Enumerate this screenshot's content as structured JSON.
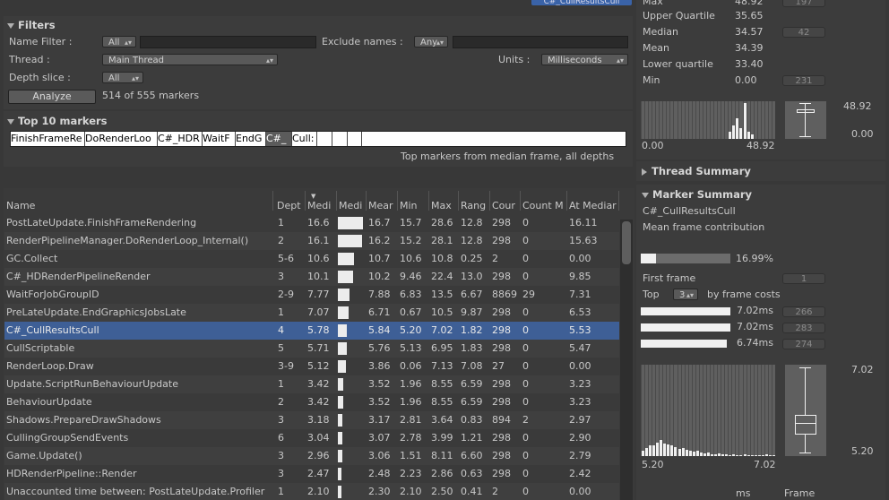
{
  "filters": {
    "title": "Filters",
    "name_filter_label": "Name Filter :",
    "name_filter_dropdown": "All",
    "exclude_names_label": "Exclude names :",
    "exclude_dropdown": "Any",
    "thread_label": "Thread :",
    "thread_value": "Main Thread",
    "units_label": "Units :",
    "units_value": "Milliseconds",
    "depth_label": "Depth slice :",
    "depth_value": "All",
    "analyze_button": "Analyze",
    "marker_count": "514 of 555 markers"
  },
  "top_markers": {
    "title": "Top 10 markers",
    "segments": [
      "FinishFrameRe",
      "DoRenderLoo",
      "C#_HDR",
      "WaitF",
      "EndG",
      "C#_",
      "Cull:",
      "",
      "",
      ""
    ],
    "caption": "Top markers from median frame, all depths"
  },
  "table": {
    "columns": [
      "Name",
      "Dept",
      "Medi",
      "Medi",
      "Mear",
      "Min",
      "Max",
      "Rang",
      "Cour",
      "Count M",
      "At Mediar"
    ],
    "rows": [
      {
        "name": "PostLateUpdate.FinishFrameRendering",
        "depth": "1",
        "median": "16.6",
        "bar": 1.0,
        "mean": "16.7",
        "min": "15.7",
        "max": "28.6",
        "range": "12.8",
        "count": "298",
        "count_m": "0",
        "at_median": "16.11"
      },
      {
        "name": "RenderPipelineManager.DoRenderLoop_Internal()",
        "depth": "2",
        "median": "16.1",
        "bar": 0.97,
        "mean": "16.2",
        "min": "15.2",
        "max": "28.1",
        "range": "12.8",
        "count": "298",
        "count_m": "0",
        "at_median": "15.63"
      },
      {
        "name": "GC.Collect",
        "depth": "5-6",
        "median": "10.6",
        "bar": 0.64,
        "mean": "10.7",
        "min": "10.6",
        "max": "10.8",
        "range": "0.25",
        "count": "2",
        "count_m": "0",
        "at_median": "0.00"
      },
      {
        "name": "C#_HDRenderPipelineRender",
        "depth": "3",
        "median": "10.1",
        "bar": 0.61,
        "mean": "10.2",
        "min": "9.46",
        "max": "22.4",
        "range": "13.0",
        "count": "298",
        "count_m": "0",
        "at_median": "9.85"
      },
      {
        "name": "WaitForJobGroupID",
        "depth": "2-9",
        "median": "7.77",
        "bar": 0.47,
        "mean": "7.88",
        "min": "6.83",
        "max": "13.5",
        "range": "6.67",
        "count": "8869",
        "count_m": "29",
        "at_median": "7.31"
      },
      {
        "name": "PreLateUpdate.EndGraphicsJobsLate",
        "depth": "1",
        "median": "7.07",
        "bar": 0.43,
        "mean": "6.71",
        "min": "0.67",
        "max": "10.5",
        "range": "9.87",
        "count": "298",
        "count_m": "0",
        "at_median": "6.53"
      },
      {
        "name": "C#_CullResultsCull",
        "depth": "4",
        "median": "5.78",
        "bar": 0.35,
        "mean": "5.84",
        "min": "5.20",
        "max": "7.02",
        "range": "1.82",
        "count": "298",
        "count_m": "0",
        "at_median": "5.53",
        "selected": true
      },
      {
        "name": "CullScriptable",
        "depth": "5",
        "median": "5.71",
        "bar": 0.34,
        "mean": "5.76",
        "min": "5.13",
        "max": "6.95",
        "range": "1.83",
        "count": "298",
        "count_m": "0",
        "at_median": "5.47"
      },
      {
        "name": "RenderLoop.Draw",
        "depth": "3-9",
        "median": "5.12",
        "bar": 0.31,
        "mean": "3.86",
        "min": "0.06",
        "max": "7.13",
        "range": "7.08",
        "count": "27",
        "count_m": "0",
        "at_median": "0.00"
      },
      {
        "name": "Update.ScriptRunBehaviourUpdate",
        "depth": "1",
        "median": "3.42",
        "bar": 0.21,
        "mean": "3.52",
        "min": "1.96",
        "max": "8.55",
        "range": "6.59",
        "count": "298",
        "count_m": "0",
        "at_median": "3.23"
      },
      {
        "name": "BehaviourUpdate",
        "depth": "2",
        "median": "3.42",
        "bar": 0.21,
        "mean": "3.52",
        "min": "1.96",
        "max": "8.55",
        "range": "6.59",
        "count": "298",
        "count_m": "0",
        "at_median": "3.23"
      },
      {
        "name": "Shadows.PrepareDrawShadows",
        "depth": "3",
        "median": "3.18",
        "bar": 0.19,
        "mean": "3.17",
        "min": "2.81",
        "max": "3.64",
        "range": "0.83",
        "count": "894",
        "count_m": "2",
        "at_median": "2.97"
      },
      {
        "name": "CullingGroupSendEvents",
        "depth": "6",
        "median": "3.04",
        "bar": 0.18,
        "mean": "3.07",
        "min": "2.78",
        "max": "3.99",
        "range": "1.21",
        "count": "298",
        "count_m": "0",
        "at_median": "2.90"
      },
      {
        "name": "Game.Update()",
        "depth": "3",
        "median": "2.96",
        "bar": 0.18,
        "mean": "3.06",
        "min": "1.51",
        "max": "8.11",
        "range": "6.60",
        "count": "298",
        "count_m": "0",
        "at_median": "2.79"
      },
      {
        "name": "HDRenderPipeline::Render",
        "depth": "3",
        "median": "2.47",
        "bar": 0.15,
        "mean": "2.48",
        "min": "2.23",
        "max": "2.86",
        "range": "0.63",
        "count": "298",
        "count_m": "0",
        "at_median": "2.42"
      },
      {
        "name": "Unaccounted time between: PostLateUpdate.Profiler",
        "depth": "1",
        "median": "2.10",
        "bar": 0.13,
        "mean": "2.30",
        "min": "2.10",
        "max": "2.50",
        "range": "0.41",
        "count": "2",
        "count_m": "0",
        "at_median": "0.00"
      }
    ]
  },
  "frame_stats": {
    "max_label": "Max",
    "max_value": "48.92",
    "max_pill": "197",
    "uq_label": "Upper Quartile",
    "uq_value": "35.65",
    "median_label": "Median",
    "median_value": "34.57",
    "median_pill": "42",
    "mean_label": "Mean",
    "mean_value": "34.39",
    "lq_label": "Lower quartile",
    "lq_value": "33.40",
    "min_label": "Min",
    "min_value": "0.00",
    "min_pill": "231",
    "hist_min": "0.00",
    "hist_max": "48.92",
    "box_top": "48.92",
    "box_bottom": "0.00"
  },
  "thread_summary": {
    "title": "Thread Summary"
  },
  "marker_summary": {
    "title": "Marker Summary",
    "marker_name": "C#_CullResultsCull",
    "contribution_label": "Mean frame contribution",
    "contribution_value": "16.99%",
    "contribution_fraction": 0.1699,
    "first_frame_label": "First frame",
    "first_frame_value": "1",
    "top_label": "Top",
    "top_value": "3",
    "by_frame_label": "by frame costs",
    "top_frames": [
      {
        "ms": "7.02ms",
        "frame": "266"
      },
      {
        "ms": "7.02ms",
        "frame": "283"
      },
      {
        "ms": "6.74ms",
        "frame": "274"
      }
    ],
    "hist_min": "5.20",
    "hist_max": "7.02",
    "box_top": "7.02",
    "box_bottom": "5.20",
    "ms_label": "ms",
    "frame_label": "Frame"
  },
  "header_link": "C#_CullResultsCull"
}
